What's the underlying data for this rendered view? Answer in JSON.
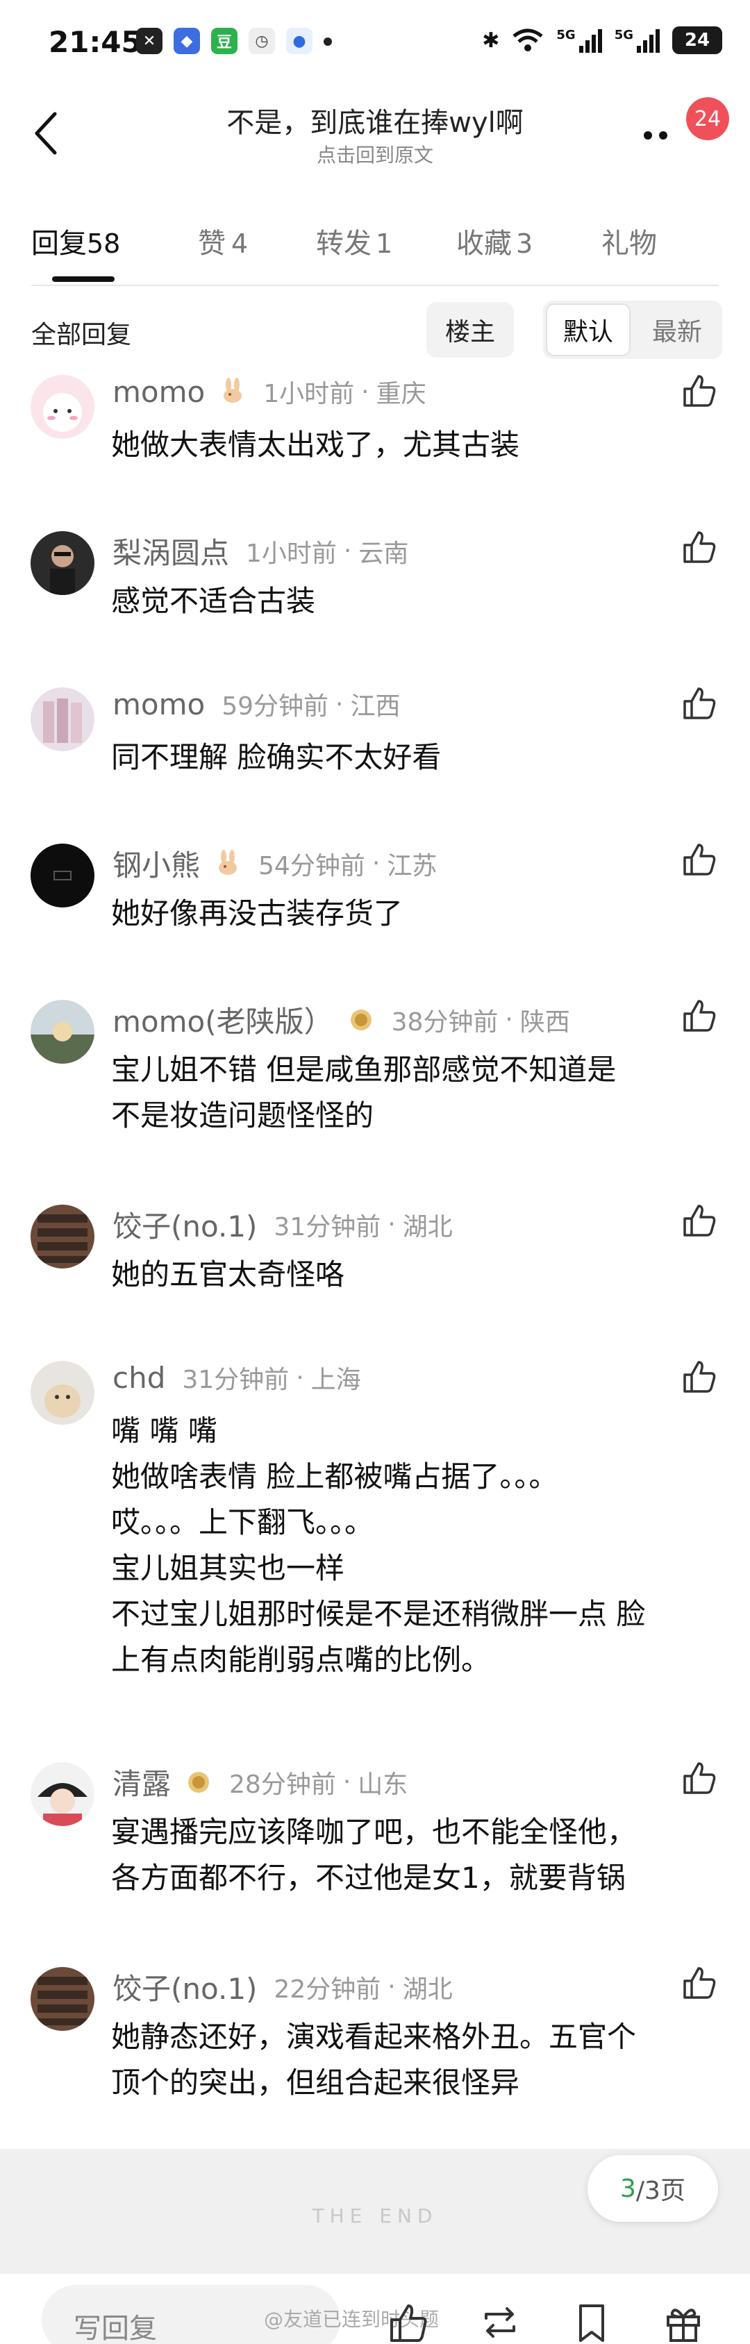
{
  "status_bar": {
    "time": "21:45",
    "network_1": "5G",
    "network_2": "5G",
    "battery": "24"
  },
  "header": {
    "title": "不是，到底谁在捧wyl啊",
    "subtitle": "点击回到原文",
    "notification_count": "24"
  },
  "tabs": [
    {
      "label": "回复",
      "count": "58"
    },
    {
      "label": "赞",
      "count": "4"
    },
    {
      "label": "转发",
      "count": "1"
    },
    {
      "label": "收藏",
      "count": "3"
    },
    {
      "label": "礼物",
      "count": ""
    }
  ],
  "filter": {
    "label": "全部回复",
    "op_button": "楼主",
    "sort_default": "默认",
    "sort_latest": "最新"
  },
  "comments": [
    {
      "name": "momo",
      "time": "1小时前",
      "loc": "重庆",
      "badge": "rabbit",
      "lines": [
        "她做大表情太出戏了，尤其古装"
      ]
    },
    {
      "name": "梨涡圆点",
      "time": "1小时前",
      "loc": "云南",
      "badge": "",
      "lines": [
        "感觉不适合古装"
      ]
    },
    {
      "name": "momo",
      "time": "59分钟前",
      "loc": "江西",
      "badge": "",
      "lines": [
        "同不理解 脸确实不太好看"
      ]
    },
    {
      "name": "钢小熊",
      "time": "54分钟前",
      "loc": "江苏",
      "badge": "rabbit",
      "lines": [
        "她好像再没古装存货了"
      ]
    },
    {
      "name": "momo(老陕版）",
      "time": "38分钟前",
      "loc": "陕西",
      "badge": "medal",
      "lines": [
        "宝儿姐不错 但是咸鱼那部感觉不知道是",
        "不是妆造问题怪怪的"
      ]
    },
    {
      "name": "饺子(no.1)",
      "time": "31分钟前",
      "loc": "湖北",
      "badge": "",
      "lines": [
        "她的五官太奇怪咯"
      ]
    },
    {
      "name": "chd",
      "time": "31分钟前",
      "loc": "上海",
      "badge": "",
      "lines": [
        "嘴 嘴 嘴",
        "她做啥表情 脸上都被嘴占据了。。。",
        "哎。。。上下翻飞。。。",
        "宝儿姐其实也一样",
        "不过宝儿姐那时候是不是还稍微胖一点 脸",
        "上有点肉能削弱点嘴的比例。"
      ]
    },
    {
      "name": "清露",
      "time": "28分钟前",
      "loc": "山东",
      "badge": "medal",
      "lines": [
        "宴遇播完应该降咖了吧，也不能全怪他，",
        "各方面都不行，不过他是女1，就要背锅"
      ]
    },
    {
      "name": "饺子(no.1)",
      "time": "22分钟前",
      "loc": "湖北",
      "badge": "",
      "lines": [
        "她静态还好，演戏看起来格外丑。五官个",
        "顶个的突出，但组合起来很怪异"
      ]
    }
  ],
  "footer": {
    "end_text": "THE END",
    "page_current": "3",
    "page_total": "/3页",
    "reply_placeholder": "写回复",
    "watermark": "@友道已连到时头题"
  },
  "colors": {
    "badge_red": "#f0505a",
    "page_green": "#2a9d4b"
  }
}
